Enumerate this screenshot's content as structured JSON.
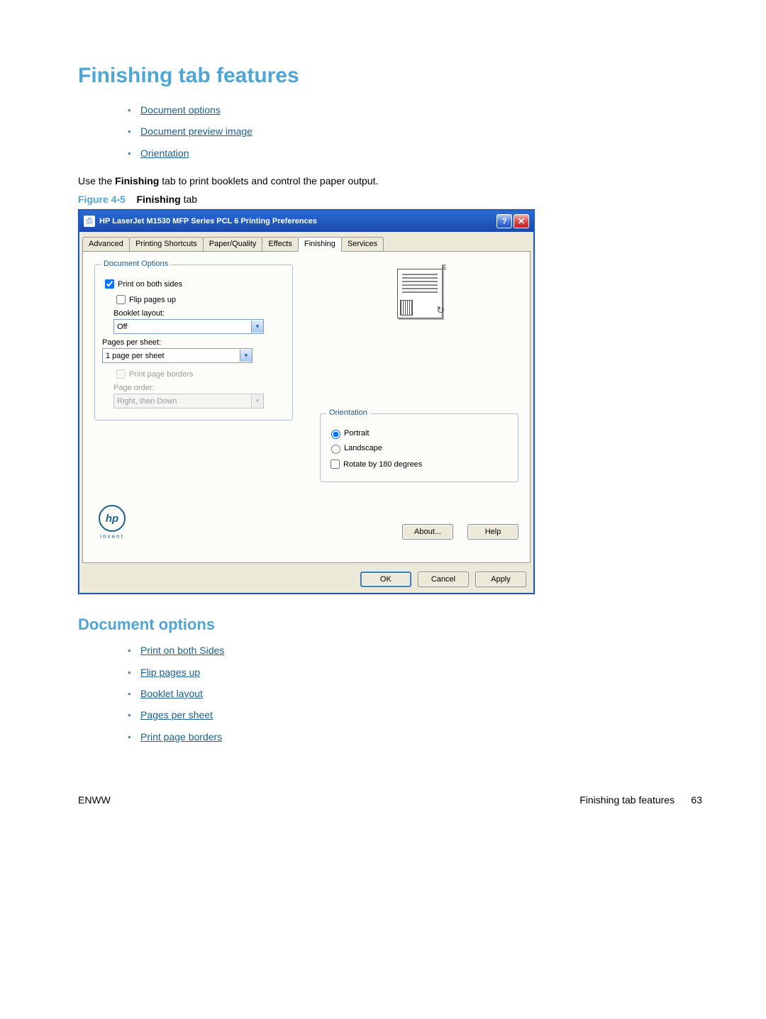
{
  "page": {
    "title": "Finishing tab features",
    "intro_links": [
      "Document options",
      "Document preview image",
      "Orientation"
    ],
    "body_text_pre": "Use the ",
    "body_text_bold": "Finishing",
    "body_text_post": " tab to print booklets and control the paper output.",
    "figure_label": "Figure 4-5",
    "figure_title_bold": "Finishing",
    "figure_title_rest": " tab",
    "sub_heading": "Document options",
    "sub_links": [
      "Print on both Sides",
      "Flip pages up",
      "Booklet layout",
      "Pages per sheet",
      "Print page borders"
    ],
    "footer_left": "ENWW",
    "footer_right": "Finishing tab features",
    "page_number": "63"
  },
  "dialog": {
    "title": "HP LaserJet M1530 MFP Series PCL 6 Printing Preferences",
    "help_glyph": "?",
    "close_glyph": "✕",
    "tabs": [
      "Advanced",
      "Printing Shortcuts",
      "Paper/Quality",
      "Effects",
      "Finishing",
      "Services"
    ],
    "active_tab_index": 4,
    "doc_options": {
      "legend": "Document Options",
      "print_both_sides": {
        "label": "Print on both sides",
        "checked": true
      },
      "flip_pages_up": {
        "label": "Flip pages up",
        "checked": false
      },
      "booklet_layout_label": "Booklet layout:",
      "booklet_layout_value": "Off",
      "pages_per_sheet_label": "Pages per sheet:",
      "pages_per_sheet_value": "1 page per sheet",
      "print_page_borders": {
        "label": "Print page borders",
        "checked": false,
        "disabled": true
      },
      "page_order_label": "Page order:",
      "page_order_value": "Right, then Down",
      "page_order_disabled": true
    },
    "orientation": {
      "legend": "Orientation",
      "portrait": "Portrait",
      "landscape": "Landscape",
      "rotate": "Rotate by 180 degrees",
      "selected": "portrait",
      "rotate_checked": false
    },
    "hp_invent": "invent",
    "hp_logo_text": "hp",
    "buttons": {
      "about": "About...",
      "help": "Help",
      "ok": "OK",
      "cancel": "Cancel",
      "apply": "Apply"
    }
  }
}
